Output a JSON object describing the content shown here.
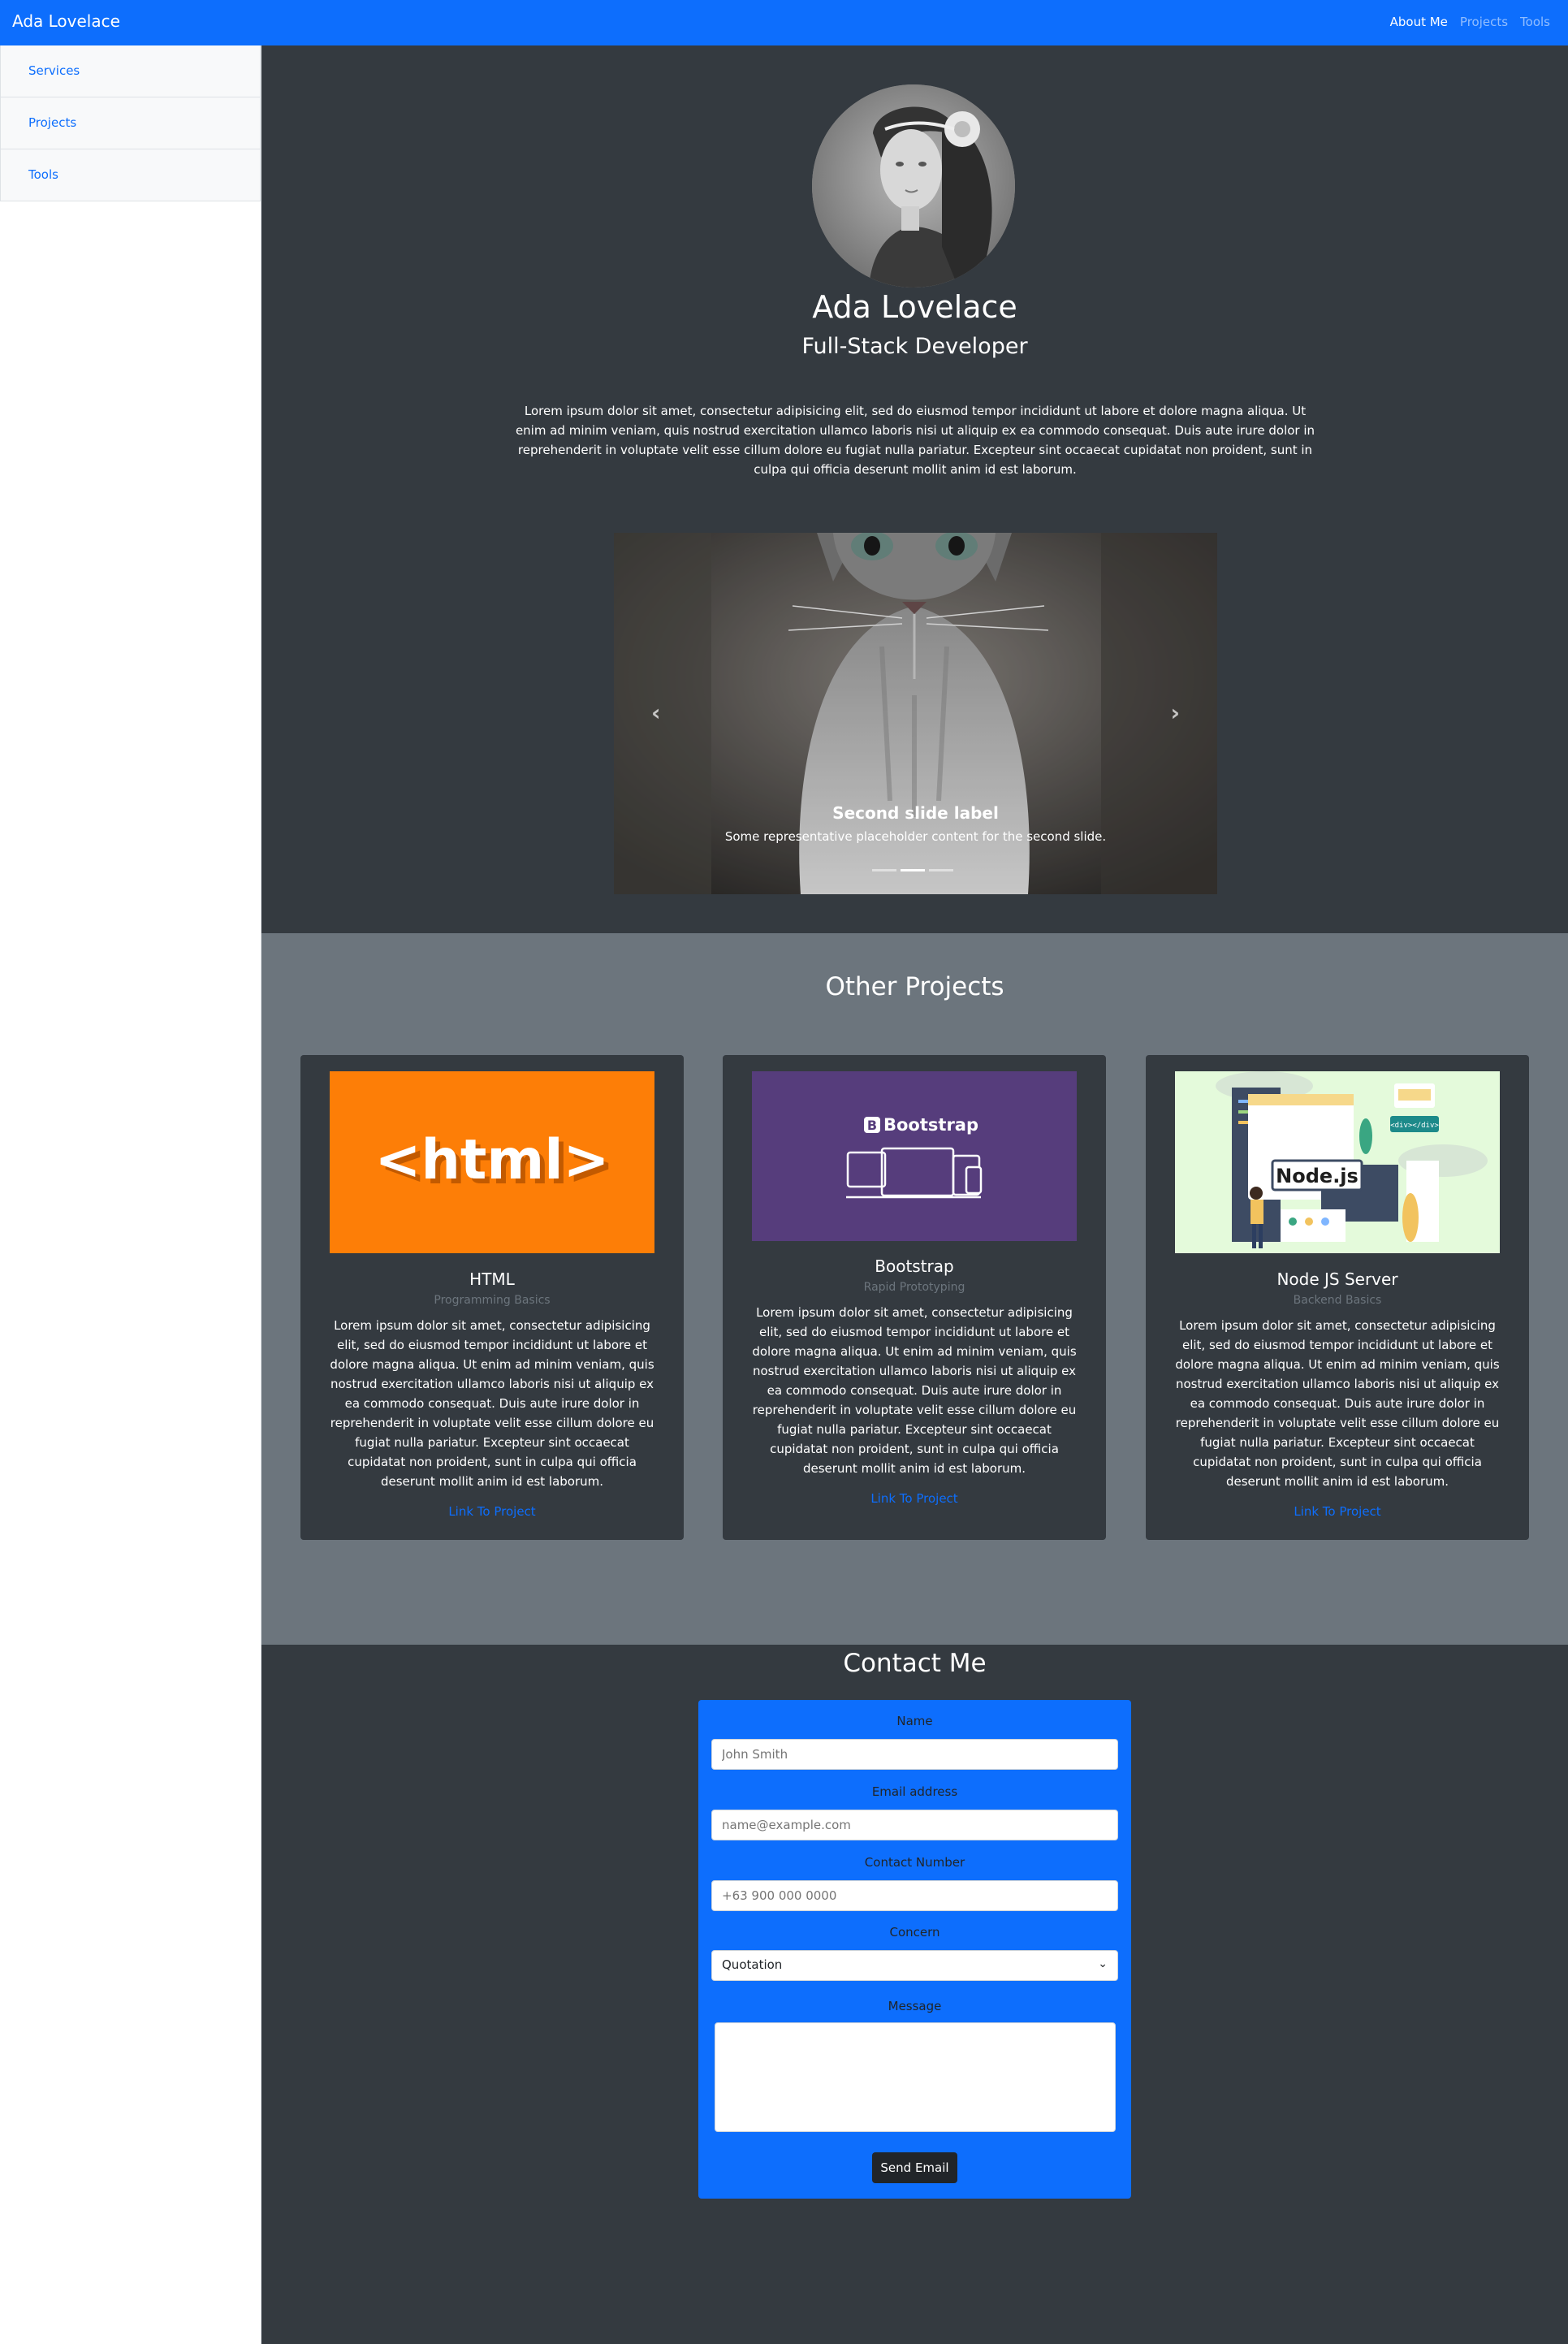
{
  "navbar": {
    "brand": "Ada Lovelace",
    "links": [
      "About Me",
      "Projects",
      "Tools"
    ]
  },
  "sidebar": {
    "items": [
      "Services",
      "Projects",
      "Tools"
    ]
  },
  "hero": {
    "name": "Ada Lovelace",
    "role": "Full-Stack Developer",
    "bio": "Lorem ipsum dolor sit amet, consectetur adipisicing elit, sed do eiusmod tempor incididunt ut labore et dolore magna aliqua. Ut enim ad minim veniam, quis nostrud exercitation ullamco laboris nisi ut aliquip ex ea commodo consequat. Duis aute irure dolor in reprehenderit in voluptate velit esse cillum dolore eu fugiat nulla pariatur. Excepteur sint occaecat cupidatat non proident, sunt in culpa qui officia deserunt mollit anim id est laborum."
  },
  "carousel": {
    "slide_title": "Second slide label",
    "slide_text": "Some representative placeholder content for the second slide.",
    "prev_icon": "chevron-left-icon",
    "next_icon": "chevron-right-icon",
    "prev_glyph": "‹",
    "next_glyph": "›",
    "active_index": 2,
    "total": 3
  },
  "projects": {
    "heading": "Other Projects",
    "cards": [
      {
        "title": "HTML",
        "subtitle": "Programming Basics",
        "text": "Lorem ipsum dolor sit amet, consectetur adipisicing elit, sed do eiusmod tempor incididunt ut labore et dolore magna aliqua. Ut enim ad minim veniam, quis nostrud exercitation ullamco laboris nisi ut aliquip ex ea commodo consequat. Duis aute irure dolor in reprehenderit in voluptate velit esse cillum dolore eu fugiat nulla pariatur. Excepteur sint occaecat cupidatat non proident, sunt in culpa qui officia deserunt mollit anim id est laborum.",
        "link": "Link To Project",
        "logo_text": "<html>"
      },
      {
        "title": "Bootstrap",
        "subtitle": "Rapid Prototyping",
        "text": "Lorem ipsum dolor sit amet, consectetur adipisicing elit, sed do eiusmod tempor incididunt ut labore et dolore magna aliqua. Ut enim ad minim veniam, quis nostrud exercitation ullamco laboris nisi ut aliquip ex ea commodo consequat. Duis aute irure dolor in reprehenderit in voluptate velit esse cillum dolore eu fugiat nulla pariatur. Excepteur sint occaecat cupidatat non proident, sunt in culpa qui officia deserunt mollit anim id est laborum.",
        "link": "Link To Project",
        "logo_text": "Bootstrap",
        "logo_letter": "B"
      },
      {
        "title": "Node JS Server",
        "subtitle": "Backend Basics",
        "text": "Lorem ipsum dolor sit amet, consectetur adipisicing elit, sed do eiusmod tempor incididunt ut labore et dolore magna aliqua. Ut enim ad minim veniam, quis nostrud exercitation ullamco laboris nisi ut aliquip ex ea commodo consequat. Duis aute irure dolor in reprehenderit in voluptate velit esse cillum dolore eu fugiat nulla pariatur. Excepteur sint occaecat cupidatat non proident, sunt in culpa qui officia deserunt mollit anim id est laborum.",
        "link": "Link To Project",
        "logo_text": "Node.js",
        "badge_text": "<div></div>"
      }
    ]
  },
  "contact": {
    "heading": "Contact Me",
    "name_label": "Name",
    "name_placeholder": "John Smith",
    "email_label": "Email address",
    "email_placeholder": "name@example.com",
    "phone_label": "Contact Number",
    "phone_placeholder": "+63 900 000 0000",
    "concern_label": "Concern",
    "concern_value": "Quotation",
    "message_label": "Message",
    "submit_label": "Send Email"
  },
  "colors": {
    "primary": "#0d6efd",
    "dark": "#343a40",
    "secondary": "#6c757d",
    "html_orange": "#fd7e07",
    "bootstrap_purple": "#563d7c",
    "node_bg": "#e4fadb"
  }
}
